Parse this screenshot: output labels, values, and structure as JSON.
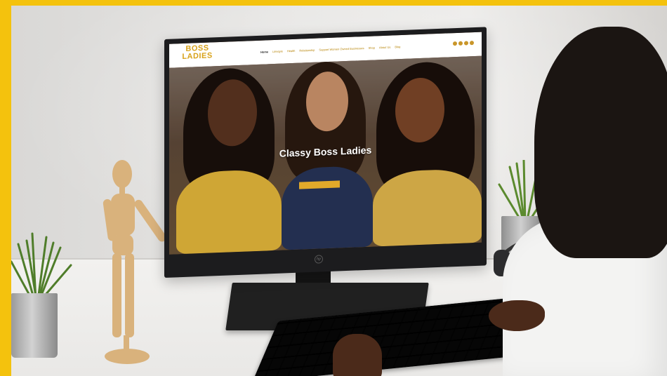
{
  "website": {
    "logo": {
      "top": "",
      "main_line1": "BOSS",
      "main_line2": "LADIES"
    },
    "nav": [
      "Home",
      "Lifestyle",
      "Health",
      "Relationship",
      "Support Women Owned Businesses",
      "Shop",
      "About Us",
      "Blog"
    ],
    "hero": {
      "kicker": "",
      "title": "Classy Boss Ladies",
      "subtitle": "",
      "button": ""
    }
  },
  "monitor": {
    "brand": "hp"
  },
  "colors": {
    "frame": "#f4c20d",
    "brand_gold": "#d8a21a",
    "button": "#e1a92a"
  }
}
